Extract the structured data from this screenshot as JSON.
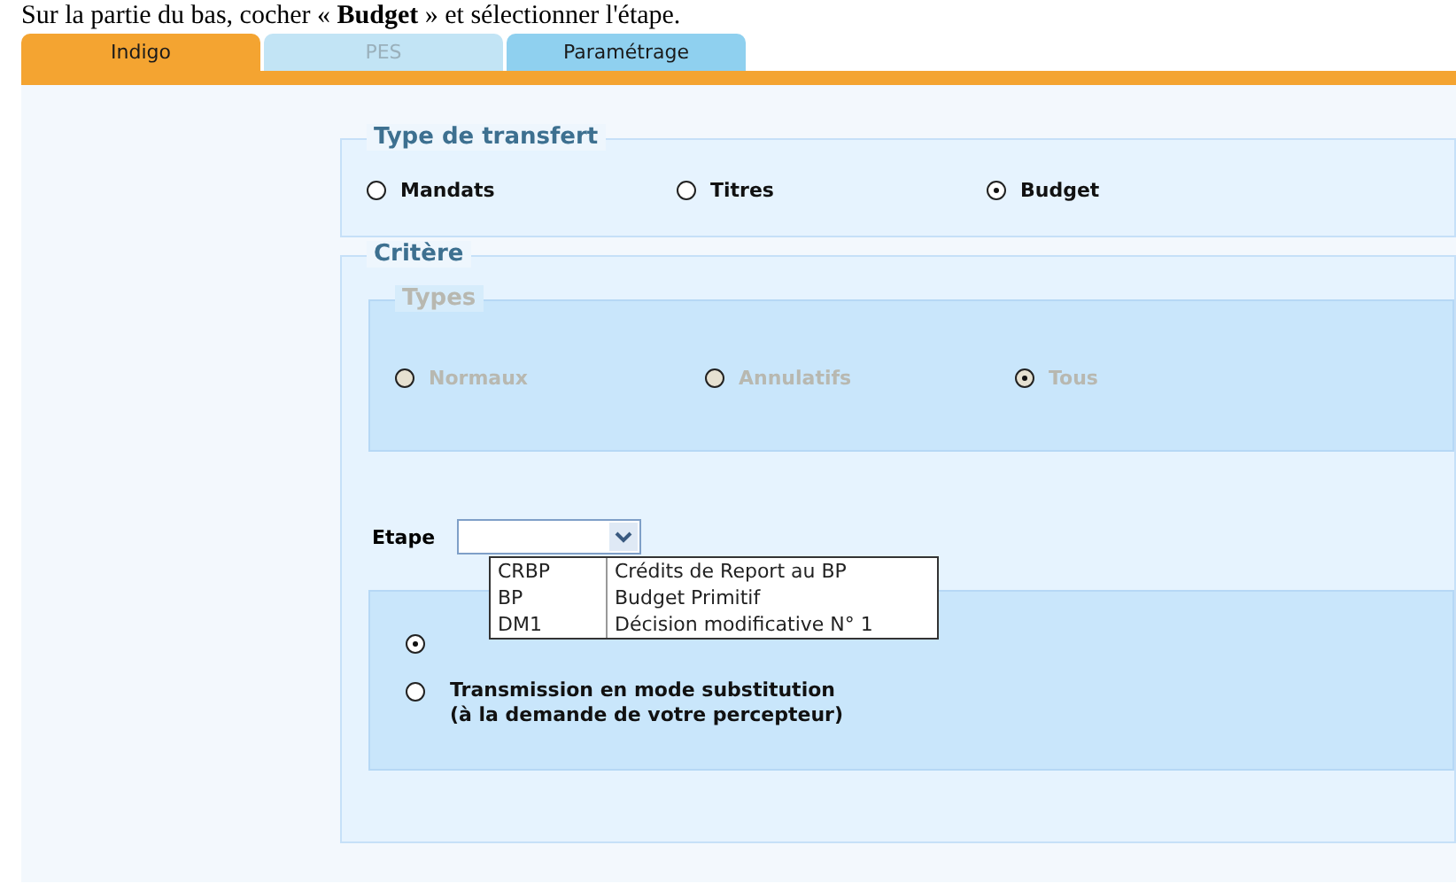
{
  "caption": "Sur la partie du bas, cocher « **Budget** » et sélectionner l'étape.",
  "tabs": [
    {
      "label": "Indigo",
      "selected": true,
      "disabled": false
    },
    {
      "label": "PES",
      "selected": false,
      "disabled": true
    },
    {
      "label": "Paramétrage",
      "selected": false,
      "disabled": false
    }
  ],
  "transfer_type": {
    "title": "Type de transfert",
    "options": [
      {
        "label": "Mandats",
        "selected": false
      },
      {
        "label": "Titres",
        "selected": false
      },
      {
        "label": "Budget",
        "selected": true
      }
    ]
  },
  "criteria": {
    "title": "Critère",
    "types": {
      "title": "Types",
      "disabled": true,
      "options": [
        {
          "label": "Normaux",
          "selected": false
        },
        {
          "label": "Annulatifs",
          "selected": false
        },
        {
          "label": "Tous",
          "selected": true
        }
      ]
    },
    "etape": {
      "label": "Etape",
      "expanded": true,
      "options": [
        {
          "code": "CRBP",
          "name": "Crédits de Report au BP"
        },
        {
          "code": "BP",
          "name": "Budget Primitif"
        },
        {
          "code": "DM1",
          "name": "Décision modificative N° 1"
        }
      ]
    },
    "transmission": [
      {
        "selected": true
      },
      {
        "label": "Transmission en mode substitution\n(à la demande de votre percepteur)",
        "selected": false
      }
    ]
  }
}
